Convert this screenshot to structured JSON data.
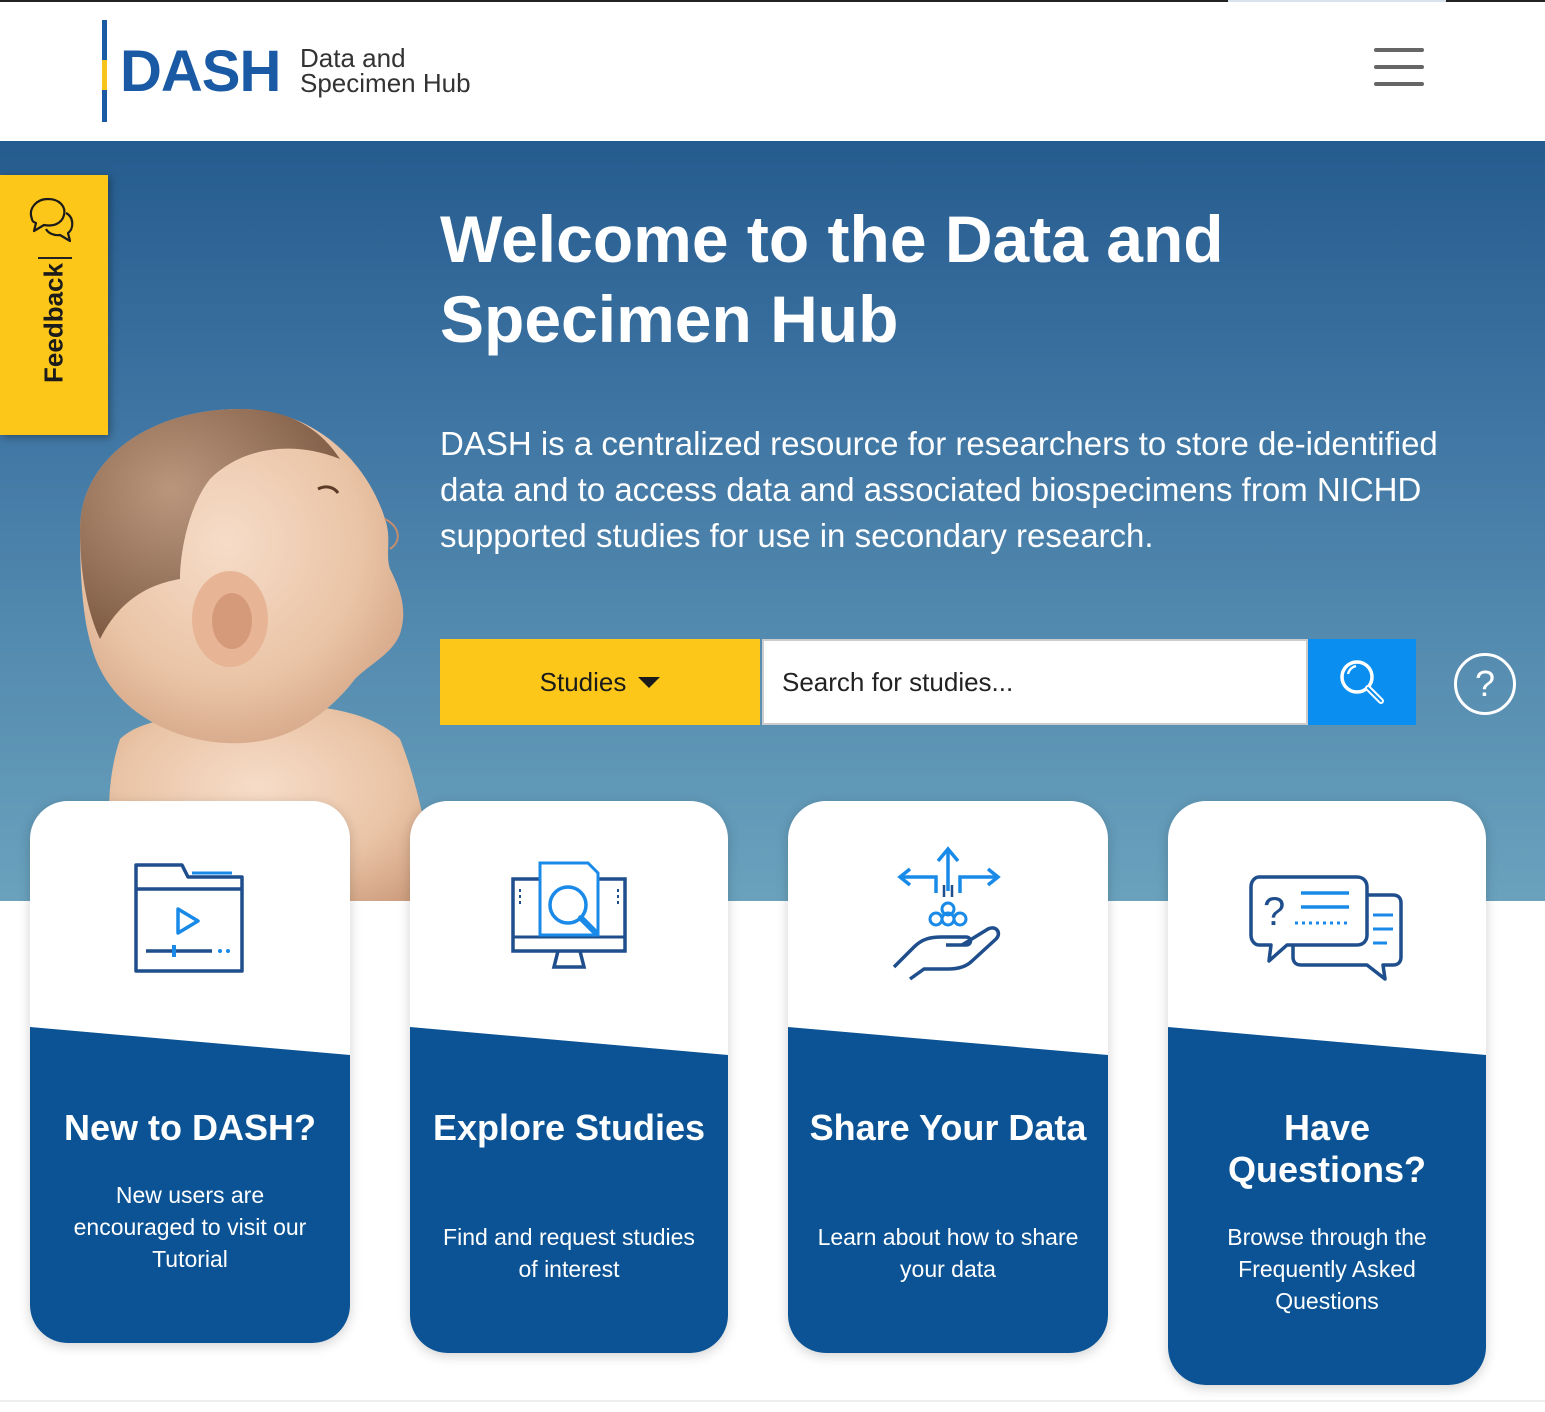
{
  "header": {
    "logo_word": "DASH",
    "logo_sub_line1": "Data and",
    "logo_sub_line2": "Specimen Hub",
    "menu_icon": "hamburger-icon"
  },
  "feedback": {
    "label": "Feedback",
    "icon": "chat-bubbles-icon"
  },
  "hero": {
    "title": "Welcome to the Data and Specimen Hub",
    "description": "DASH is a centralized resource for researchers to store de-identified data and to access data and associated biospecimens from NICHD supported studies for use in secondary research."
  },
  "search": {
    "category_selected": "Studies",
    "placeholder": "Search for studies...",
    "search_icon": "magnifier-icon",
    "help_icon": "question-circle-icon",
    "help_label": "?"
  },
  "cards": [
    {
      "title": "New to DASH?",
      "description": "New users are encouraged to visit our Tutorial",
      "icon": "video-folder-icon"
    },
    {
      "title": "Explore Studies",
      "description": "Find and request studies of interest",
      "icon": "monitor-search-icon"
    },
    {
      "title": "Share Your Data",
      "description": "Learn about how to share your data",
      "icon": "hand-share-arrows-icon"
    },
    {
      "title": "Have Questions?",
      "description": "Browse through the Frequently Asked Questions",
      "icon": "chat-question-icon"
    }
  ],
  "colors": {
    "brand_blue": "#1a5aa5",
    "card_blue": "#0b5394",
    "accent_yellow": "#fdc71a",
    "search_blue": "#0a8ff0"
  }
}
